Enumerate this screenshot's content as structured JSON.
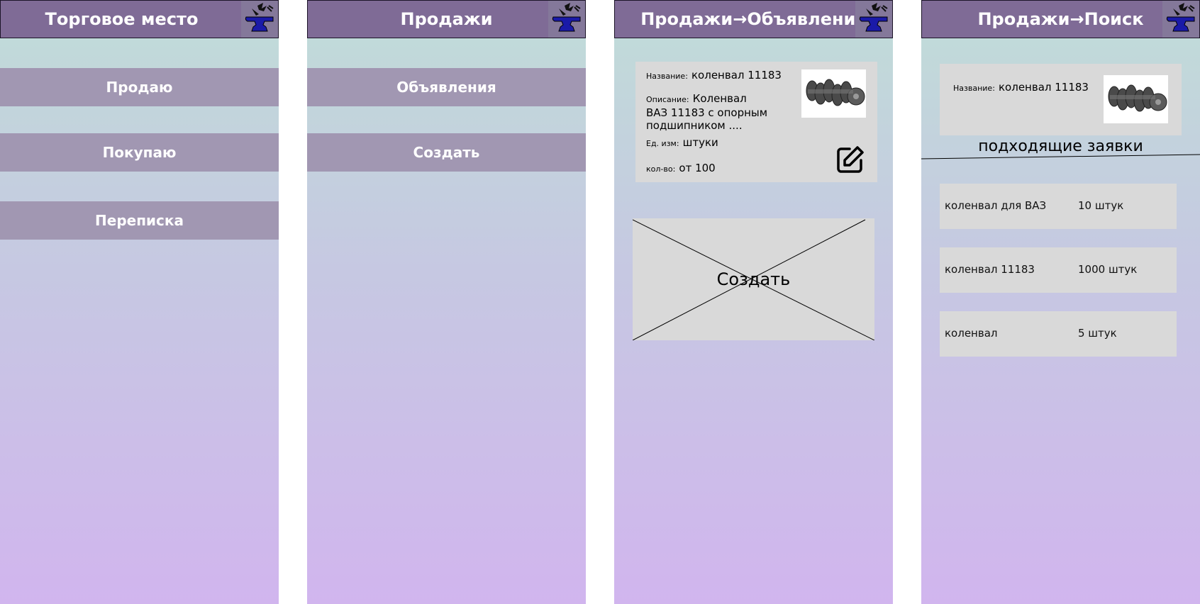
{
  "screens": [
    {
      "title": "Торговое место",
      "menu": [
        "Продаю",
        "Покупаю",
        "Переписка"
      ]
    },
    {
      "title": "Продажи",
      "menu": [
        "Объявления",
        "Создать"
      ]
    },
    {
      "title": "Продажи→Объявления",
      "ad": {
        "name_label": "Название:",
        "name_value": "коленвал 11183",
        "desc_label": "Описание:",
        "desc_value": "Коленвал ВАЗ 11183 с опорным подшипником ....",
        "unit_label": "Ед. изм:",
        "unit_value": "штуки",
        "qty_label": "кол-во:",
        "qty_value": "от 100"
      },
      "create_label": "Создать"
    },
    {
      "title": "Продажи→Поиск",
      "search": {
        "name_label": "Название:",
        "name_value": "коленвал 11183"
      },
      "section_title": "подходящие заявки",
      "results": [
        {
          "name": "коленвал для ВАЗ",
          "qty": "10 штук"
        },
        {
          "name": "коленвал 11183",
          "qty": "1000 штук"
        },
        {
          "name": "коленвал",
          "qty": "5 штук"
        }
      ]
    }
  ],
  "icons": {
    "logo": "anvil-logo-icon",
    "edit": "edit-icon",
    "product_photo": "crankshaft-photo"
  },
  "colors": {
    "header": "#7f6b96",
    "menu_button": "#a197b2",
    "card": "#d9d9d9",
    "gradient_top": "#c0ddd8",
    "gradient_bottom": "#d1b5ee",
    "logo_blue": "#1a1aa8"
  }
}
